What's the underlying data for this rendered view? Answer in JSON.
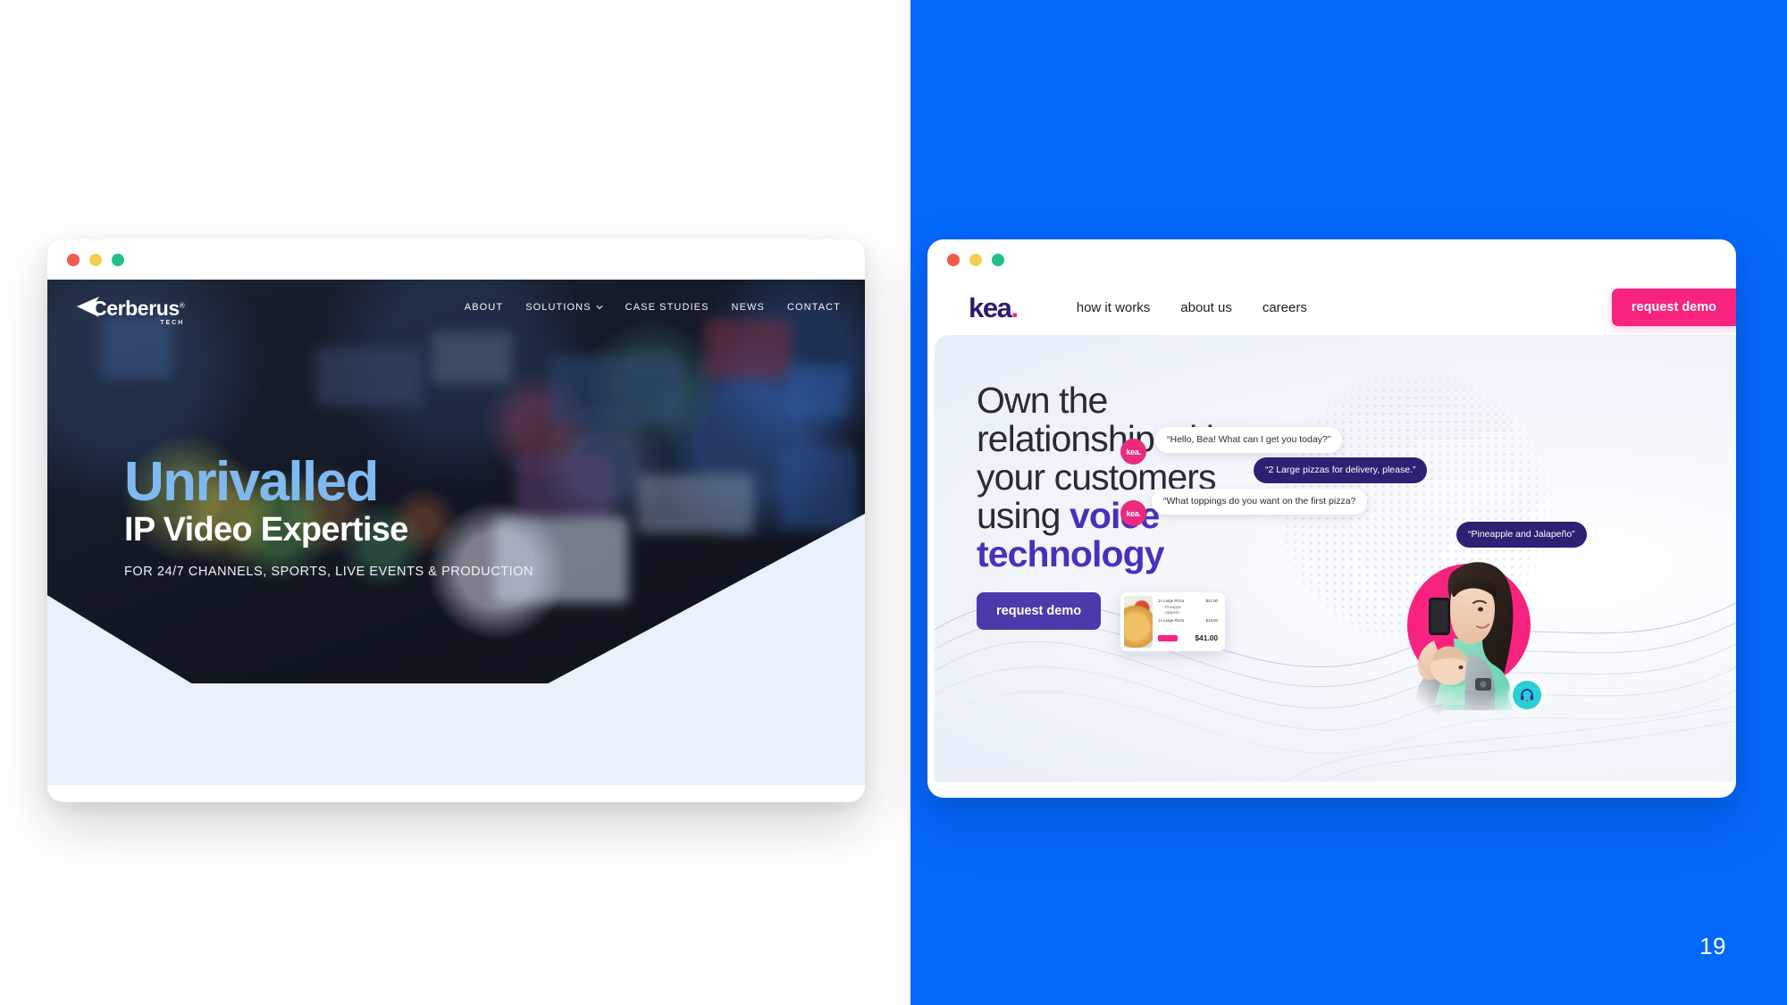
{
  "slide": {
    "page_number": "19",
    "background_accent": "#0568fd",
    "left_background": "#ffffff"
  },
  "window_controls": {
    "close": "close-dot",
    "minimize": "minimize-dot",
    "maximize": "maximize-dot",
    "colors": {
      "close": "#f05a4f",
      "minimize": "#f5ce4d",
      "maximize": "#21c08b"
    }
  },
  "cerberus": {
    "logo": {
      "name": "Cerberus",
      "trademark": "®",
      "tagline": "TECH"
    },
    "nav": [
      {
        "label": "ABOUT",
        "has_dropdown": false
      },
      {
        "label": "SOLUTIONS",
        "has_dropdown": true
      },
      {
        "label": "CASE STUDIES",
        "has_dropdown": false
      },
      {
        "label": "NEWS",
        "has_dropdown": false
      },
      {
        "label": "CONTACT",
        "has_dropdown": false
      }
    ],
    "hero": {
      "headline_accent": "Unrivalled",
      "headline": "IP Video Expertise",
      "subhead": "FOR 24/7 CHANNELS, SPORTS, LIVE EVENTS & PRODUCTION",
      "accent_color": "#7fb9f0",
      "panel_color": "#e9f1fb"
    }
  },
  "kea": {
    "logo": {
      "name": "kea",
      "dot": "."
    },
    "nav": [
      {
        "label": "how it works"
      },
      {
        "label": "about us"
      },
      {
        "label": "careers"
      }
    ],
    "header_cta": {
      "label": "request demo",
      "color": "#f8237f"
    },
    "hero": {
      "line1": "Own the",
      "line2": "relationship with",
      "line3": "your customers",
      "line4_plain": "using ",
      "line4_bold": "voice",
      "line5_bold": "technology",
      "accent_color": "#4a2fbd",
      "cta": {
        "label": "request demo",
        "color": "#4a3aab"
      }
    },
    "conversation": [
      {
        "speaker": "kea",
        "avatar": "kea.",
        "text": "“Hello, Bea! What can I get you today?”",
        "style": "light"
      },
      {
        "speaker": "customer",
        "text": "“2 Large pizzas for delivery, please.”",
        "style": "dark"
      },
      {
        "speaker": "kea",
        "avatar": "kea.",
        "text": "“What toppings do you want on the first pizza?",
        "style": "light"
      },
      {
        "speaker": "customer",
        "text": "“Pineapple and Jalapeño”",
        "style": "dark"
      }
    ],
    "order": {
      "items": [
        {
          "qty": "1x",
          "name": "Large Pizza",
          "price": "$21.50",
          "toppings": [
            "- Pineapple",
            "- Jalapeño"
          ]
        },
        {
          "qty": "1x",
          "name": "Large Pizza",
          "price": "$19.50",
          "toppings": [
            "-"
          ]
        }
      ],
      "total": "$41.00"
    },
    "photo": {
      "alt": "woman on phone holding baby",
      "badge_icon": "headset-icon",
      "badge_color": "#28cfd4",
      "circle_color": "#f8237f"
    }
  }
}
